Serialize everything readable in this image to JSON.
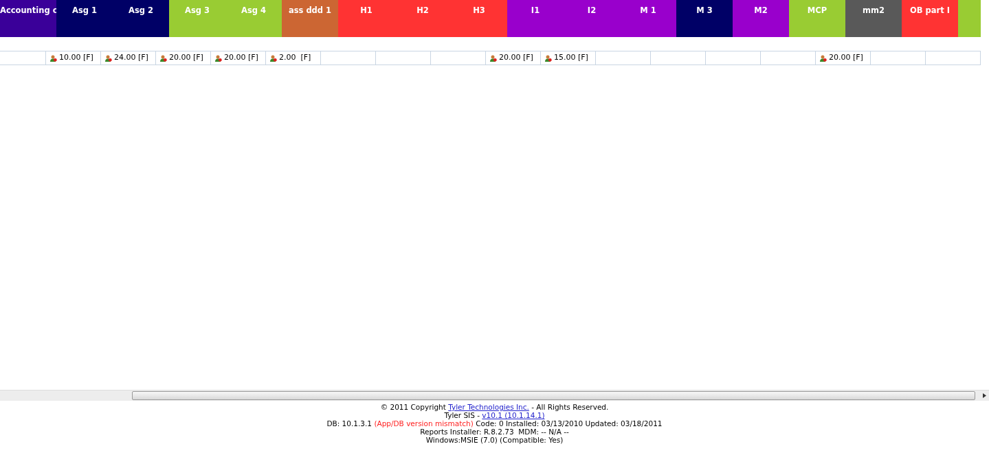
{
  "header_columns": [
    {
      "label": "Accounting c",
      "color": "#3a0099"
    },
    {
      "label": "Asg 1",
      "color": "#000066"
    },
    {
      "label": "Asg 2",
      "color": "#000066"
    },
    {
      "label": "Asg 3",
      "color": "#99cc33"
    },
    {
      "label": "Asg 4",
      "color": "#99cc33"
    },
    {
      "label": "ass ddd 1",
      "color": "#cc6633"
    },
    {
      "label": "H1",
      "color": "#ff3333"
    },
    {
      "label": "H2",
      "color": "#ff3333"
    },
    {
      "label": "H3",
      "color": "#ff3333"
    },
    {
      "label": "I1",
      "color": "#9900cc"
    },
    {
      "label": "I2",
      "color": "#9900cc"
    },
    {
      "label": "M 1",
      "color": "#9900cc"
    },
    {
      "label": "M 3",
      "color": "#000066"
    },
    {
      "label": "M2",
      "color": "#9900cc"
    },
    {
      "label": "MCP",
      "color": "#99cc33"
    },
    {
      "label": "mm2",
      "color": "#595959"
    },
    {
      "label": "OB part I",
      "color": "#ff3333"
    },
    {
      "color": "#99cc33"
    }
  ],
  "score_cells": [
    {},
    {
      "score": "10.00 [F]"
    },
    {
      "score": "24.00 [F]"
    },
    {
      "score": "20.00 [F]"
    },
    {
      "score": "20.00 [F]"
    },
    {
      "score": "2.00  [F]"
    },
    {},
    {},
    {},
    {
      "score": "20.00 [F]"
    },
    {
      "score": "15.00 [F]"
    },
    {},
    {},
    {},
    {},
    {
      "score": "20.00 [F]"
    },
    {},
    {}
  ],
  "footer_lines": [
    [
      {
        "kind": "text",
        "text": "© 2011 Copyright "
      },
      {
        "kind": "link",
        "text": "Tyler Technologies Inc."
      },
      {
        "kind": "text",
        "text": " - All Rights Reserved."
      }
    ],
    [
      {
        "kind": "text",
        "text": "Tyler SIS - "
      },
      {
        "kind": "link",
        "text": "v10.1 (10.1.14.1)"
      }
    ],
    [
      {
        "kind": "text",
        "text": "DB: 10.1.3.1 "
      },
      {
        "kind": "warning",
        "text": "(App/DB version mismatch)"
      },
      {
        "kind": "text",
        "text": " Code: 0 Installed: 03/13/2010 Updated: 03/18/2011"
      }
    ],
    [
      {
        "kind": "text",
        "text": "Reports Installer: R.8.2.73  MDM: -- N/A --"
      }
    ],
    [
      {
        "kind": "text",
        "text": "Windows:MSIE (7.0) (Compatible: Yes)"
      }
    ]
  ]
}
